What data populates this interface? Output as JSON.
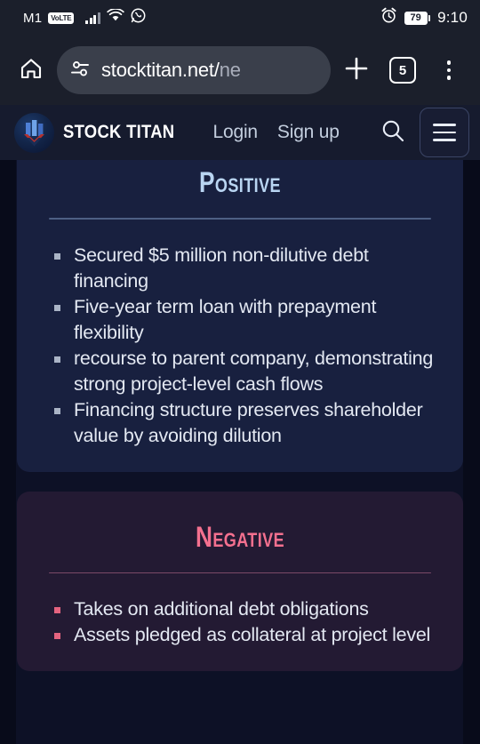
{
  "status_bar": {
    "carrier": "M1",
    "network_badge": "VoLTE",
    "battery_percent": "79",
    "time": "9:10",
    "icons": [
      "signal-bars-icon",
      "wifi-icon",
      "whatsapp-icon",
      "alarm-clock-icon",
      "battery-icon"
    ]
  },
  "browser": {
    "home_icon": "home-icon",
    "site_settings_icon": "page-settings-icon",
    "url_text": "stocktitan.net/",
    "url_dim": "ne",
    "new_tab_icon": "plus-icon",
    "tab_count": "5",
    "menu_icon": "kebab-menu-icon"
  },
  "site_header": {
    "logo_icon": "stock-titan-logo-icon",
    "brand_name": "STOCK TITAN",
    "links": [
      {
        "label": "Login"
      },
      {
        "label": "Sign up"
      }
    ],
    "search_icon": "search-icon",
    "menu_icon": "hamburger-menu-icon"
  },
  "content": {
    "sections": [
      {
        "title": "Positive",
        "tone": "positive",
        "accent": "#b9d5f2",
        "background": "#18203f",
        "bullets": [
          "Secured $5 million non-dilutive debt financing",
          "Five-year term loan with prepayment flexibility",
          "recourse to parent company, demonstrating strong project-level cash flows",
          "Financing structure preserves shareholder value by avoiding dilution"
        ]
      },
      {
        "title": "Negative",
        "tone": "negative",
        "accent": "#f4708f",
        "background": "#231a33",
        "bullets": [
          "Takes on additional debt obligations",
          "Assets pledged as collateral at project level"
        ]
      }
    ]
  }
}
